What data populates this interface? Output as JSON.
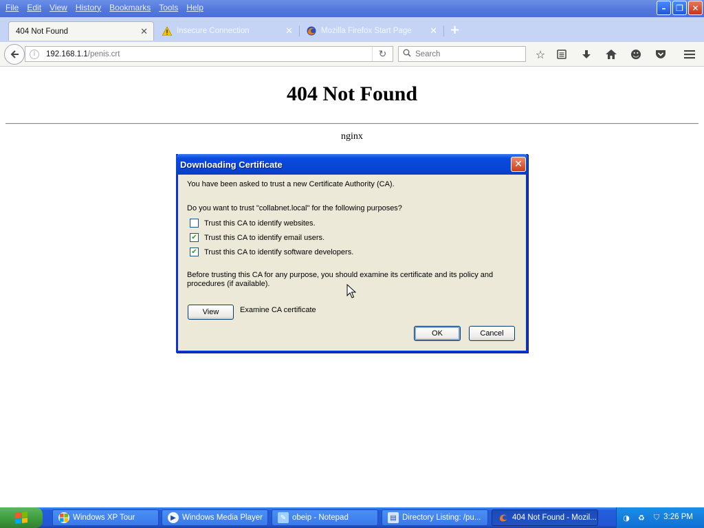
{
  "menu": [
    "File",
    "Edit",
    "View",
    "History",
    "Bookmarks",
    "Tools",
    "Help"
  ],
  "window_controls": {
    "minimize": "–",
    "restore": "❐",
    "close": "✕"
  },
  "tabs": [
    {
      "label": "404 Not Found",
      "active": true
    },
    {
      "label": "Insecure Connection",
      "active": false
    },
    {
      "label": "Mozilla Firefox Start Page",
      "active": false
    }
  ],
  "tab_close_glyph": "✕",
  "new_tab_glyph": "+",
  "address": {
    "host": "192.168.1.1",
    "path": "/penis.crt"
  },
  "search": {
    "placeholder": "Search"
  },
  "page": {
    "heading": "404 Not Found",
    "server": "nginx"
  },
  "dialog": {
    "title": "Downloading Certificate",
    "close_glyph": "✕",
    "intro": "You have been asked to trust a new Certificate Authority (CA).",
    "question": "Do you want to trust \"collabnet.local\" for the following purposes?",
    "options": [
      {
        "label": "Trust this CA to identify websites.",
        "checked": false
      },
      {
        "label": "Trust this CA to identify email users.",
        "checked": true
      },
      {
        "label": "Trust this CA to identify software developers.",
        "checked": true
      }
    ],
    "advice": "Before trusting this CA for any purpose, you should examine its certificate and its policy and procedures (if available).",
    "view_button": "View",
    "examine_label": "Examine CA certificate",
    "ok_button": "OK",
    "cancel_button": "Cancel"
  },
  "taskbar": {
    "items": [
      {
        "label": "Windows XP Tour",
        "active": false
      },
      {
        "label": "Windows Media Player",
        "active": false
      },
      {
        "label": "obeip - Notepad",
        "active": false
      },
      {
        "label": "Directory Listing: /pu...",
        "active": false
      },
      {
        "label": "404 Not Found - Mozil...",
        "active": true
      }
    ],
    "clock": "3:26 PM"
  },
  "colors": {
    "xp_blue": "#245edb",
    "dialog_face": "#ece9d8",
    "check_green": "#21a121"
  }
}
